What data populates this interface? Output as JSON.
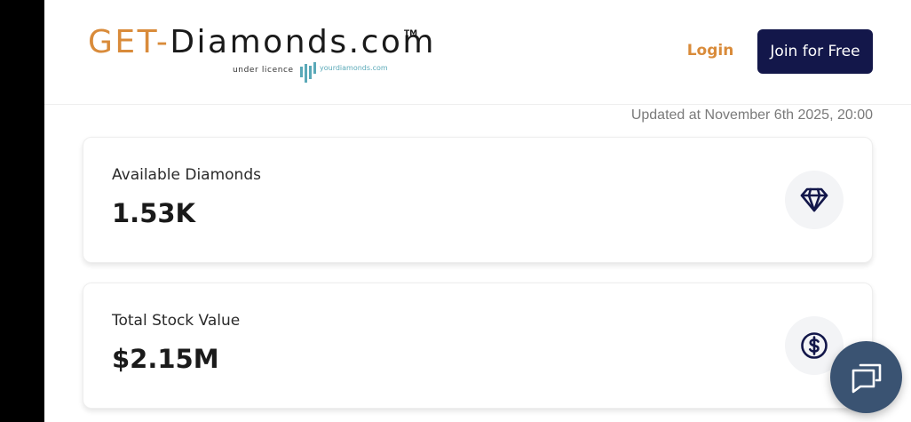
{
  "brand": {
    "logo_prefix": "GET-",
    "logo_main": "Diamonds.com",
    "trademark": "TM",
    "licence_text": "under licence",
    "partner_text": "yourdiamonds.com",
    "colors": {
      "accent": "#d98b3a",
      "navy": "#13174a",
      "partner": "#5aa9b8"
    }
  },
  "header": {
    "login_label": "Login",
    "join_label": "Join for Free"
  },
  "updated_text": "Updated at November 6th 2025, 20:00",
  "stats": [
    {
      "label": "Available Diamonds",
      "value": "1.53K",
      "icon": "diamond-icon"
    },
    {
      "label": "Total Stock Value",
      "value": "$2.15M",
      "icon": "dollar-circle-icon"
    }
  ],
  "chat": {
    "icon": "chat-icon"
  }
}
